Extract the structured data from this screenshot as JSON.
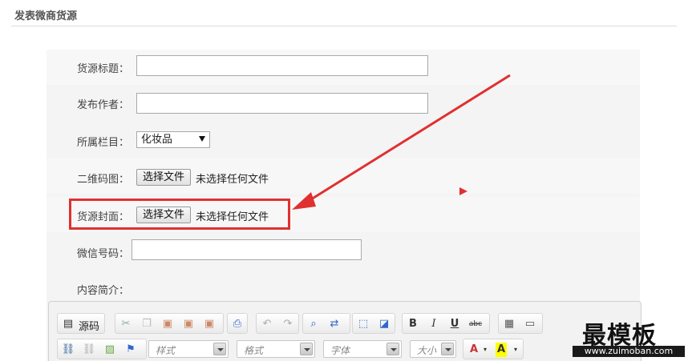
{
  "header": {
    "title": "发表微商货源"
  },
  "form": {
    "title_label": "货源标题：",
    "author_label": "发布作者：",
    "category_label": "所属栏目：",
    "category_selected": "化妆品",
    "qrcode_label": "二维码图：",
    "qrcode_button": "选择文件",
    "qrcode_status": "未选择任何文件",
    "cover_label": "货源封面：",
    "cover_button": "选择文件",
    "cover_status": "未选择任何文件",
    "wechat_label": "微信号码：",
    "intro_label": "内容简介："
  },
  "editor": {
    "source_label": "源码",
    "style_placeholder": "样式",
    "format_placeholder": "格式",
    "font_placeholder": "字体",
    "size_placeholder": "大小",
    "bold": "B",
    "italic": "I",
    "underline": "U",
    "strike": "abc"
  },
  "watermark": {
    "title": "最模板",
    "url": "www.zuimoban.com"
  },
  "colors": {
    "highlight": "#e03030",
    "arrow": "#e03030"
  }
}
